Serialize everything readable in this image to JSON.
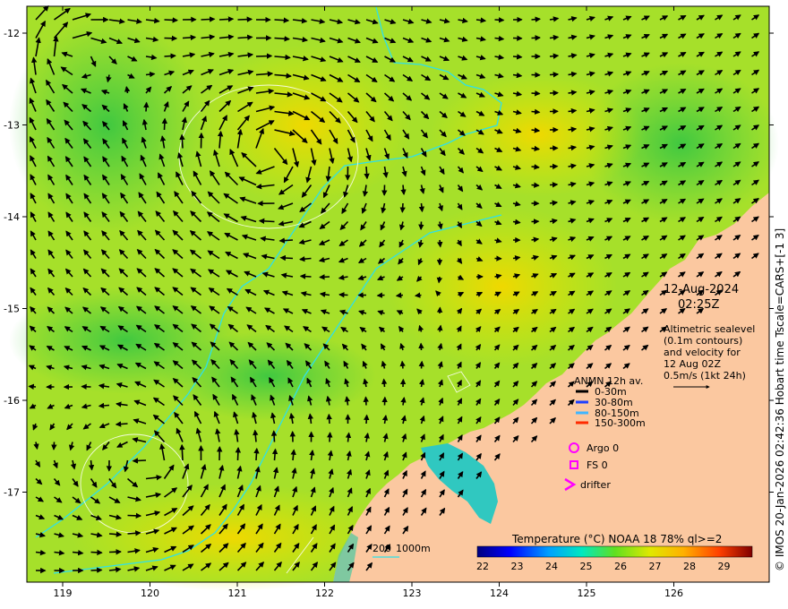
{
  "map": {
    "date": "12-Aug-2024",
    "time": "02:25Z",
    "lon_ticks": [
      "119",
      "120",
      "121",
      "122",
      "123",
      "124",
      "125",
      "126"
    ],
    "lat_ticks": [
      "-12",
      "-13",
      "-14",
      "-15",
      "-16",
      "-17"
    ],
    "description_lines": [
      "Altimetric sealevel",
      "(0.1m contours)",
      "and velocity for",
      "12 Aug 02Z",
      "0.5m/s (1kt 24h)"
    ],
    "mooring_legend": {
      "title": "ANMN 12h av.",
      "items": [
        {
          "label": "0-30m",
          "color": "#000000"
        },
        {
          "label": "30-80m",
          "color": "#1e40ff"
        },
        {
          "label": "80-150m",
          "color": "#3fb6ff"
        },
        {
          "label": "150-300m",
          "color": "#ff2a00"
        }
      ]
    },
    "platform_legend": [
      {
        "label": "Argo 0",
        "symbol": "circle",
        "color": "#ff00ff"
      },
      {
        "label": "FS 0",
        "symbol": "square",
        "color": "#ff00ff"
      },
      {
        "label": "drifter",
        "symbol": "chevron",
        "color": "#ff00ff"
      }
    ],
    "depth_legend": [
      "200",
      "1000m"
    ],
    "colorbar": {
      "title": "Temperature (°C) NOAA 18 78% ql>=2",
      "ticks": [
        "22",
        "23",
        "24",
        "25",
        "26",
        "27",
        "28",
        "29"
      ]
    },
    "side_credit": "© IMOS 20-Jan-2026 02:42:36 Hobart time Tscale=CARS+[-1 3]",
    "colors": {
      "land": "#fbc8a0",
      "ocean_main": "#9be02a",
      "warm": "#e8e000",
      "isobath": "#2fe0e8"
    }
  }
}
